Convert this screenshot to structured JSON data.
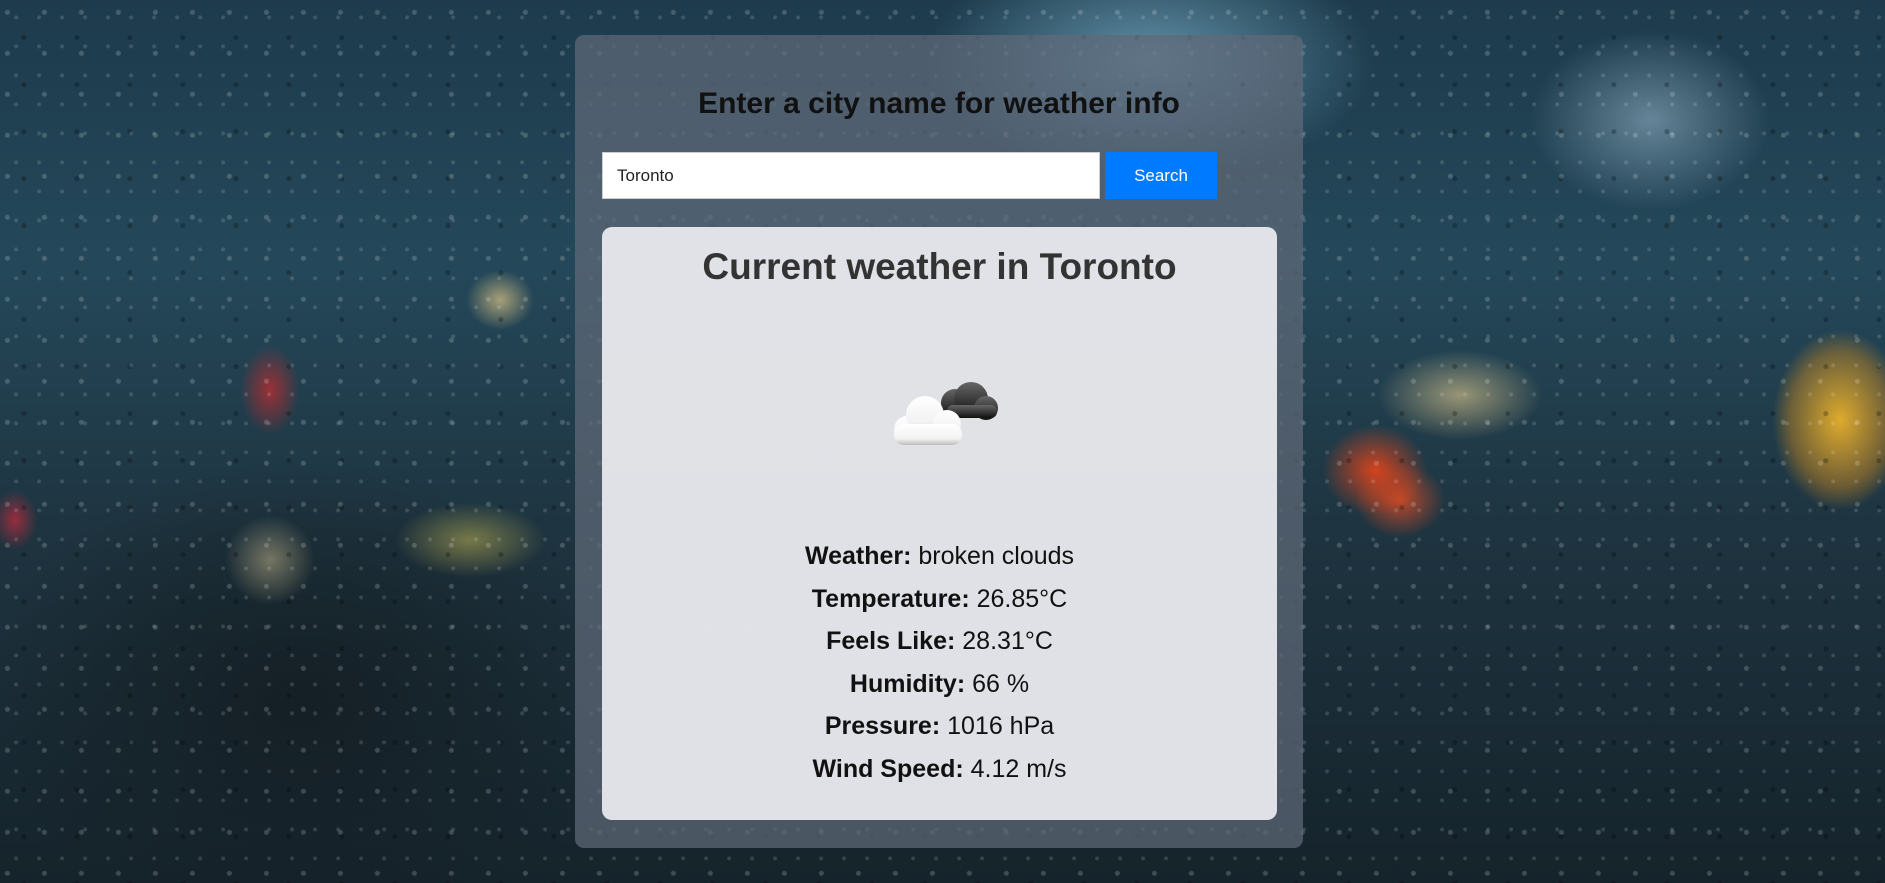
{
  "search": {
    "heading": "Enter a city name for weather info",
    "value": "Toronto",
    "button_label": "Search"
  },
  "result": {
    "title": "Current weather in Toronto",
    "icon": "broken-clouds-icon",
    "rows": [
      {
        "label": "Weather:",
        "value": "broken clouds"
      },
      {
        "label": "Temperature:",
        "value": "26.85°C"
      },
      {
        "label": "Feels Like:",
        "value": "28.31°C"
      },
      {
        "label": "Humidity:",
        "value": "66 %"
      },
      {
        "label": "Pressure:",
        "value": "1016 hPa"
      },
      {
        "label": "Wind Speed:",
        "value": "4.12 m/s"
      }
    ]
  },
  "colors": {
    "button": "#007bff",
    "panel": "#5f6978",
    "card": "#e8e9ed"
  }
}
